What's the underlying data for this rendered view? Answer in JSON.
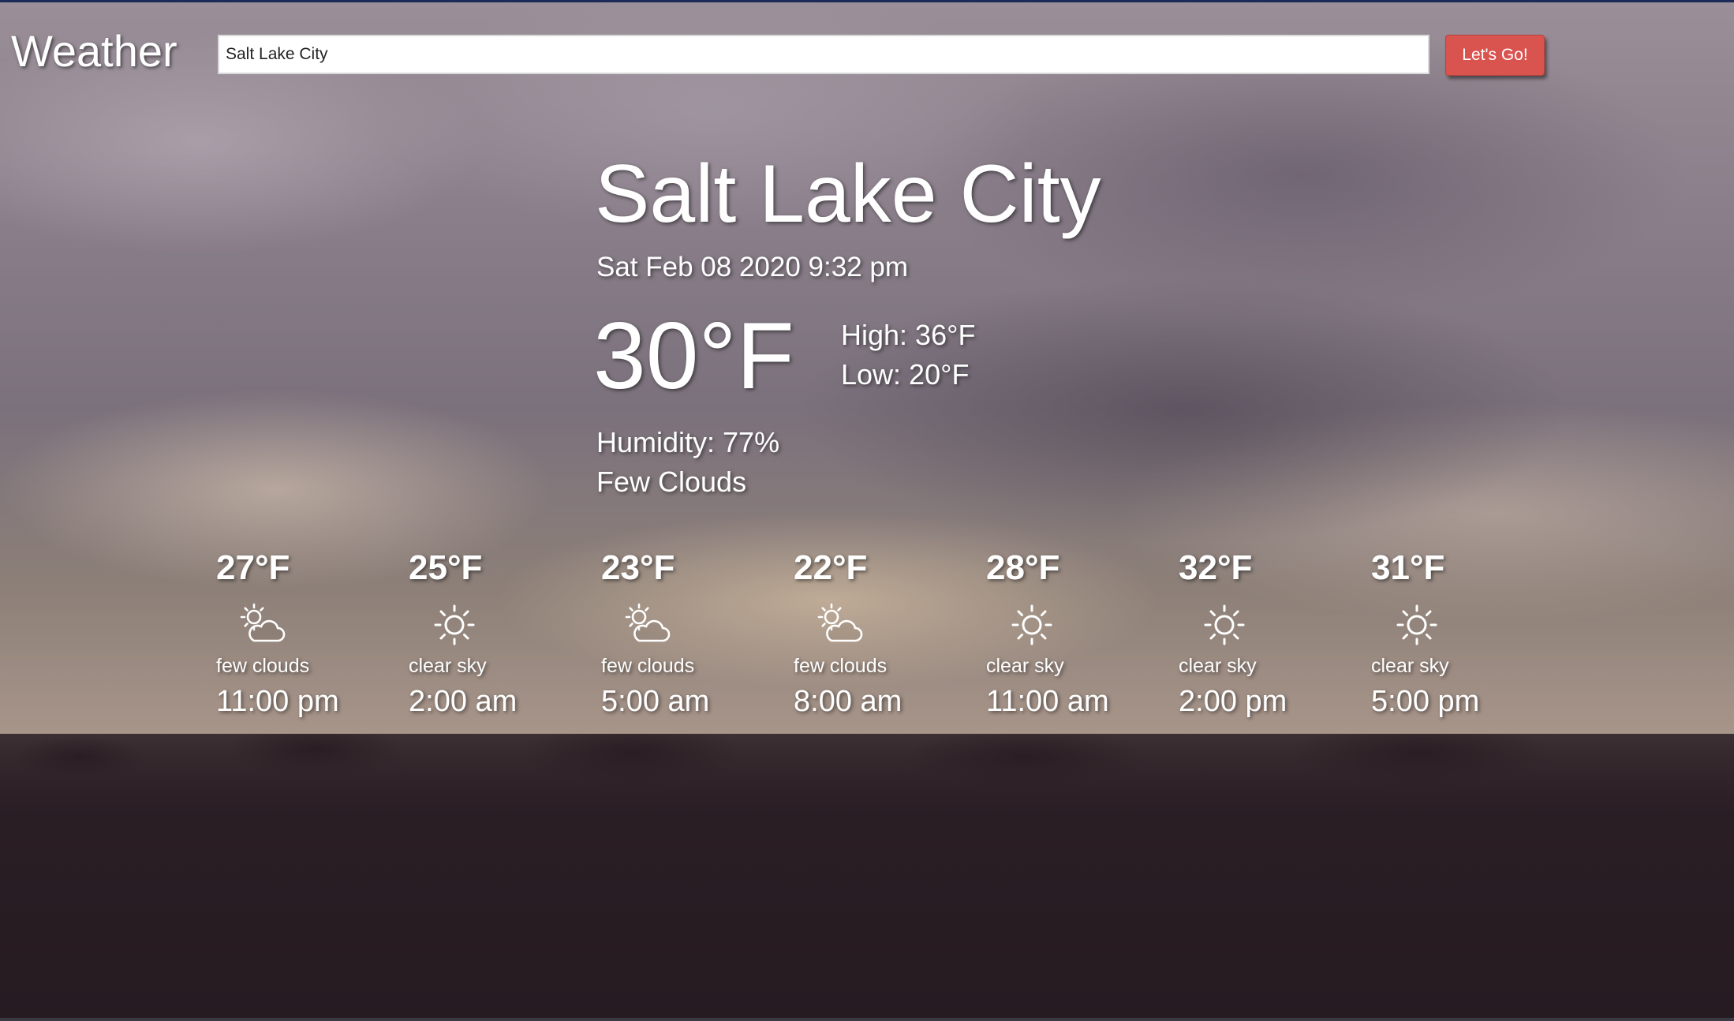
{
  "header": {
    "brand": "Weather",
    "search_value": "Salt Lake City",
    "go_label": "Let's Go!"
  },
  "current": {
    "city": "Salt Lake City",
    "datetime": "Sat Feb 08 2020 9:32 pm",
    "temperature": "30°F",
    "high": "High: 36°F",
    "low": "Low: 20°F",
    "humidity": "Humidity: 77%",
    "condition": "Few Clouds"
  },
  "forecast": [
    {
      "temp": "27°F",
      "icon": "partly-cloudy-icon",
      "desc": "few clouds",
      "time": "11:00 pm"
    },
    {
      "temp": "25°F",
      "icon": "sun-icon",
      "desc": "clear sky",
      "time": "2:00 am"
    },
    {
      "temp": "23°F",
      "icon": "partly-cloudy-icon",
      "desc": "few clouds",
      "time": "5:00 am"
    },
    {
      "temp": "22°F",
      "icon": "partly-cloudy-icon",
      "desc": "few clouds",
      "time": "8:00 am"
    },
    {
      "temp": "28°F",
      "icon": "sun-icon",
      "desc": "clear sky",
      "time": "11:00 am"
    },
    {
      "temp": "32°F",
      "icon": "sun-icon",
      "desc": "clear sky",
      "time": "2:00 pm"
    },
    {
      "temp": "31°F",
      "icon": "sun-icon",
      "desc": "clear sky",
      "time": "5:00 pm"
    }
  ]
}
